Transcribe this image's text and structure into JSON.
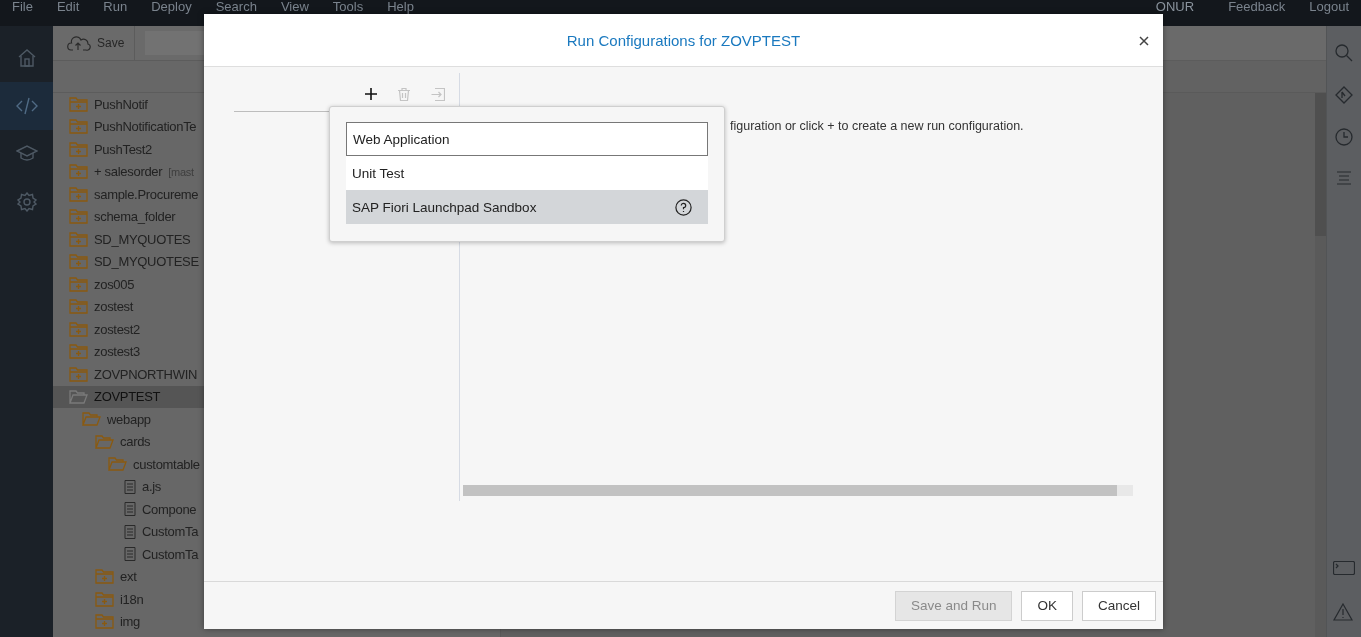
{
  "menu_bar": {
    "items": [
      "File",
      "Edit",
      "Run",
      "Deploy",
      "Search",
      "View",
      "Tools",
      "Help"
    ],
    "user": "ONUR",
    "links": [
      "Feedback",
      "Logout"
    ]
  },
  "activity_bar": [
    {
      "selected": false
    },
    {
      "selected": true
    },
    {
      "selected": false
    },
    {
      "selected": false
    }
  ],
  "toolbar": {
    "save_label": "Save"
  },
  "tree": [
    {
      "label": "PushNotif",
      "kind": "folder",
      "expanded": false,
      "selected": false
    },
    {
      "label": "PushNotificationTe",
      "kind": "folder",
      "expanded": false,
      "selected": false
    },
    {
      "label": "PushTest2",
      "kind": "folder",
      "expanded": false,
      "selected": false
    },
    {
      "label": "+ salesorder",
      "branch": "[mast",
      "kind": "folder",
      "expanded": false,
      "selected": false
    },
    {
      "label": "sample.Procureme",
      "kind": "folder",
      "expanded": false,
      "selected": false
    },
    {
      "label": "schema_folder",
      "kind": "folder",
      "expanded": false,
      "selected": false
    },
    {
      "label": "SD_MYQUOTES",
      "kind": "folder",
      "expanded": false,
      "selected": false
    },
    {
      "label": "SD_MYQUOTESE",
      "kind": "folder",
      "expanded": false,
      "selected": false
    },
    {
      "label": "zos005",
      "kind": "folder",
      "expanded": false,
      "selected": false
    },
    {
      "label": "zostest",
      "kind": "folder",
      "expanded": false,
      "selected": false
    },
    {
      "label": "zostest2",
      "kind": "folder",
      "expanded": false,
      "selected": false
    },
    {
      "label": "zostest3",
      "kind": "folder",
      "expanded": false,
      "selected": false
    },
    {
      "label": "ZOVPNORTHWIN",
      "kind": "folder",
      "expanded": false,
      "selected": false
    },
    {
      "label": "ZOVPTEST",
      "kind": "folder",
      "expanded": true,
      "selected": true,
      "children": [
        {
          "label": "webapp",
          "kind": "folder",
          "expanded": true,
          "selected": false,
          "children": [
            {
              "label": "cards",
              "kind": "folder",
              "expanded": true,
              "selected": false,
              "children": [
                {
                  "label": "customtable",
                  "kind": "folder",
                  "expanded": true,
                  "selected": false,
                  "children": [
                    {
                      "label": "a.js",
                      "kind": "file",
                      "selected": false
                    },
                    {
                      "label": "Compone",
                      "kind": "file",
                      "selected": false
                    },
                    {
                      "label": "CustomTa",
                      "kind": "file",
                      "selected": false
                    },
                    {
                      "label": "CustomTa",
                      "kind": "file",
                      "selected": false
                    }
                  ]
                }
              ]
            },
            {
              "label": "ext",
              "kind": "folder",
              "expanded": false,
              "selected": false
            },
            {
              "label": "i18n",
              "kind": "folder",
              "expanded": false,
              "selected": false
            },
            {
              "label": "img",
              "kind": "folder",
              "expanded": false,
              "selected": false
            }
          ]
        }
      ]
    }
  ],
  "dialog": {
    "title": "Run Configurations for ZOVPTEST",
    "actions": [
      {
        "disabled": false
      },
      {
        "disabled": true
      },
      {
        "disabled": true
      }
    ],
    "hint": "figuration or click + to create a new run configuration.",
    "popup": {
      "field_value": "Web Application",
      "options": [
        {
          "label": "Unit Test",
          "selected": false,
          "help": false
        },
        {
          "label": "SAP Fiori Launchpad Sandbox",
          "selected": true,
          "help": true
        }
      ]
    },
    "buttons": [
      {
        "label": "Save and Run",
        "disabled": true
      },
      {
        "label": "OK",
        "disabled": false
      },
      {
        "label": "Cancel",
        "disabled": false
      }
    ]
  }
}
